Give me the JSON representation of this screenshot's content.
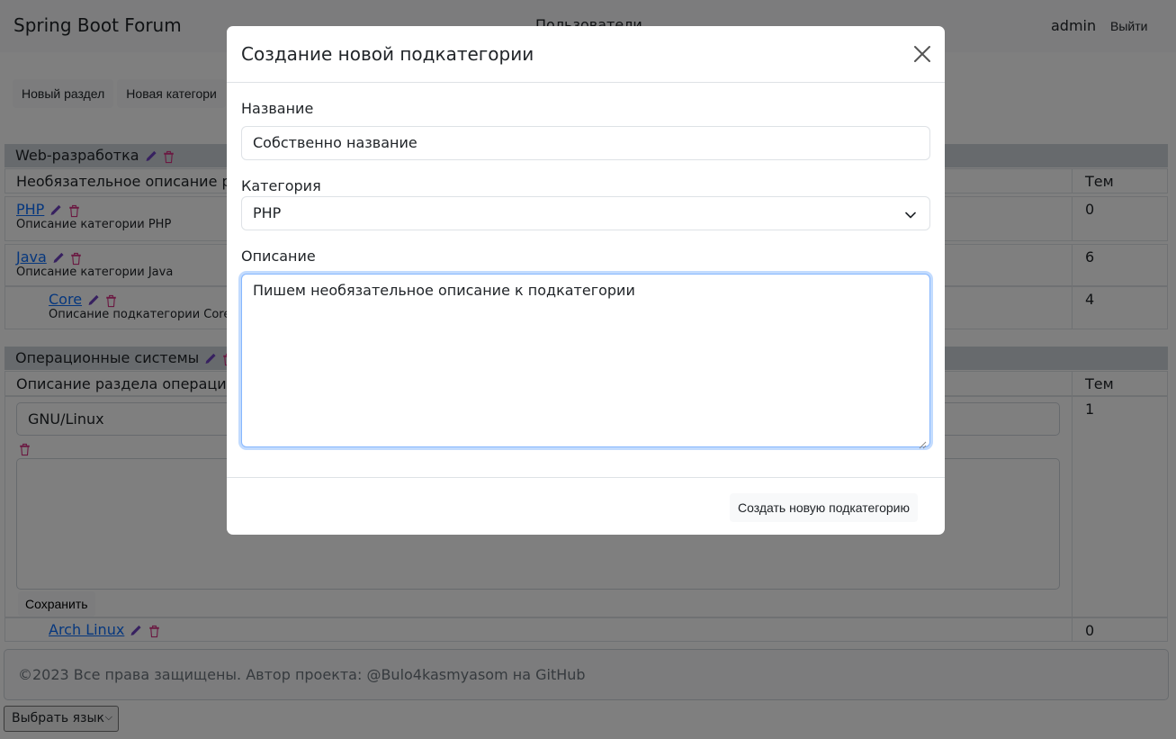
{
  "header": {
    "brand": "Spring Boot Forum",
    "nav_users": "Пользователи",
    "username": "admin",
    "logout": "Выйти"
  },
  "toolbar": {
    "new_section": "Новый раздел",
    "new_category": "Новая категори"
  },
  "forum": {
    "sections": [
      {
        "title": "Web-разработка",
        "description": "Необязательное описание раз",
        "topics_header": "Тем",
        "categories": [
          {
            "name": "PHP",
            "description": "Описание категории PHP",
            "topics": "0"
          },
          {
            "name": "Java",
            "description": "Описание категории Java",
            "topics": "6"
          }
        ],
        "subcategories": [
          {
            "name": "Core",
            "description": "Описание подкатегории Core",
            "topics": "4"
          }
        ]
      },
      {
        "title": "Операционные системы",
        "description": "Описание раздела операцион",
        "topics_header": "Тем",
        "edit_category": {
          "name_value": "GNU/Linux",
          "topics": "1",
          "save_label": "Сохранить"
        },
        "subcategories": [
          {
            "name": "Arch Linux",
            "topics": "0"
          }
        ]
      }
    ]
  },
  "footer": {
    "text": "©2023 Все права защищены. Автор проекта: @Bulo4kasmyasom на GitHub"
  },
  "language_select": {
    "selected": "Выбрать язык"
  },
  "modal": {
    "title": "Создание новой подкатегории",
    "name_label": "Название",
    "name_value": "Собственно название",
    "category_label": "Категория",
    "category_selected": "PHP",
    "description_label": "Описание",
    "description_value": "Пишем необязательное описание к подкатегории",
    "submit": "Создать новую подкатегорию"
  },
  "icons": {
    "edit": "pencil-icon",
    "delete": "trash-icon",
    "close": "close-icon",
    "dropdown": "chevron-down-icon"
  },
  "colors": {
    "pencil": "#6f42c1",
    "trash": "#d63384",
    "link": "#0d6efd",
    "focus_ring": "#86b7fe"
  }
}
